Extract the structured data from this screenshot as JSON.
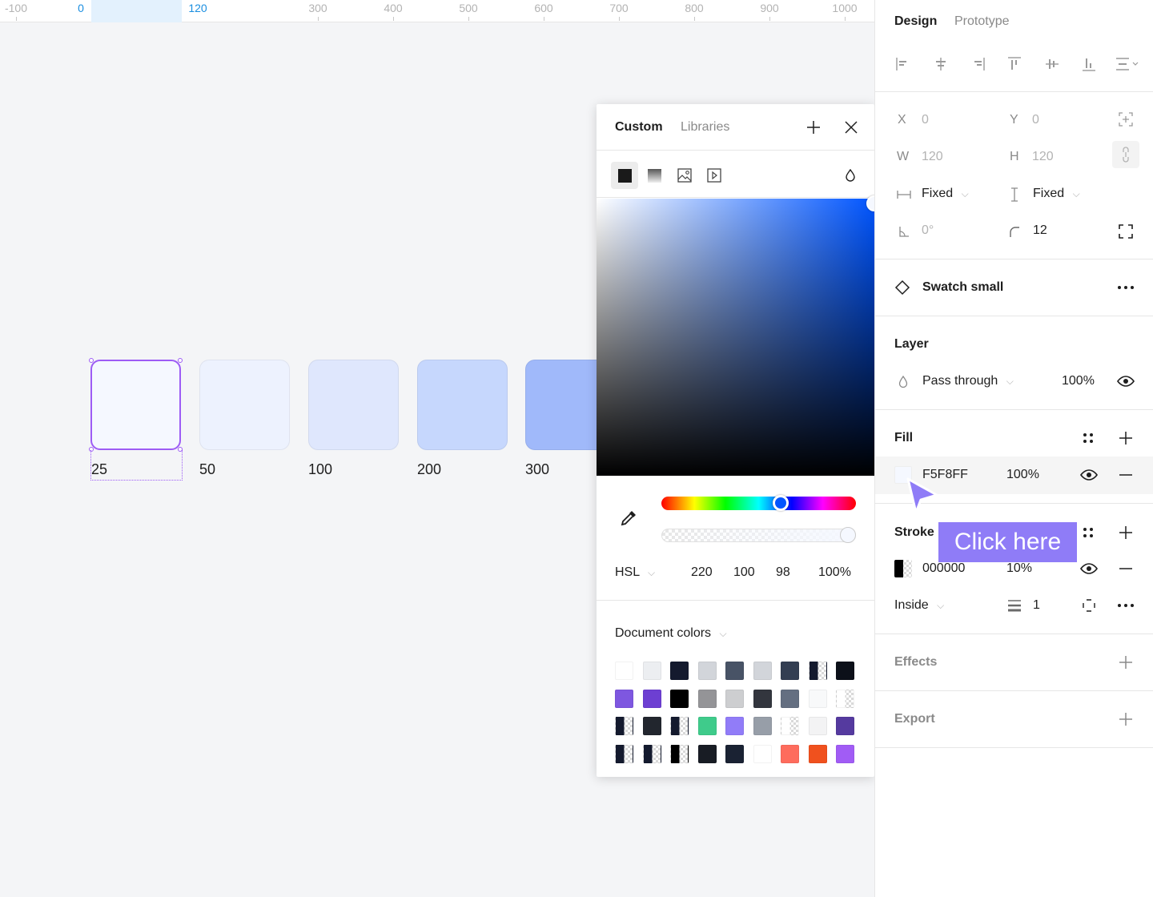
{
  "ruler": {
    "labels": [
      {
        "text": "-100",
        "active": false
      },
      {
        "text": "0",
        "active": true
      },
      {
        "text": "120",
        "active": true
      },
      {
        "text": "300",
        "active": false
      },
      {
        "text": "400",
        "active": false
      },
      {
        "text": "500",
        "active": false
      },
      {
        "text": "600",
        "active": false
      },
      {
        "text": "700",
        "active": false
      },
      {
        "text": "800",
        "active": false
      },
      {
        "text": "900",
        "active": false
      },
      {
        "text": "1000",
        "active": false
      }
    ]
  },
  "canvas": {
    "swatches": [
      {
        "label": "25",
        "color": "#F5F8FF",
        "selected": true
      },
      {
        "label": "50",
        "color": "#EDF2FE"
      },
      {
        "label": "100",
        "color": "#DFE7FD"
      },
      {
        "label": "200",
        "color": "#C6D7FD"
      },
      {
        "label": "300",
        "color": "#A0B9FA"
      }
    ],
    "selection_color": "#9D5CF5"
  },
  "picker": {
    "tabs": {
      "custom": "Custom",
      "libraries": "Libraries"
    },
    "icons": {
      "add": "plus-icon",
      "close": "close-icon",
      "solid": "solid-fill-icon",
      "gradient": "gradient-fill-icon",
      "image": "image-fill-icon",
      "video": "video-fill-icon",
      "blend": "blend-mode-icon",
      "eyedropper": "eyedropper-icon"
    },
    "hue_degrees": 220,
    "alpha_percent": 100,
    "mode": "HSL",
    "h": "220",
    "s": "100",
    "l": "98",
    "a": "100%",
    "doc_colors_label": "Document colors",
    "doc_colors": [
      {
        "c": "#FFFFFF"
      },
      {
        "c": "#ECEEF1"
      },
      {
        "c": "#141A2E"
      },
      {
        "c": "#D2D5DA"
      },
      {
        "c": "#485366"
      },
      {
        "c": "#D2D5DA"
      },
      {
        "c": "#333E52"
      },
      {
        "c": "#141A2E",
        "half": true
      },
      {
        "c": "#0C1019"
      },
      {
        "c": "#7E57E0"
      },
      {
        "c": "#6D3FD2"
      },
      {
        "c": "#000000"
      },
      {
        "c": "#949497"
      },
      {
        "c": "#CDCED0"
      },
      {
        "c": "#33363E"
      },
      {
        "c": "#646F81"
      },
      {
        "c": "#F8F9FA"
      },
      {
        "c": "#FFFFFF",
        "half": true
      },
      {
        "c": "#141A2E",
        "half": true
      },
      {
        "c": "#22262E"
      },
      {
        "c": "#141A2E",
        "half": true
      },
      {
        "c": "#3FCB8B"
      },
      {
        "c": "#917CF8"
      },
      {
        "c": "#979EA8"
      },
      {
        "c": "#FFFFFF",
        "half": true
      },
      {
        "c": "#F3F3F4"
      },
      {
        "c": "#553A9F"
      },
      {
        "c": "#141A2E",
        "half": true
      },
      {
        "c": "#141A2E",
        "half": true
      },
      {
        "c": "#000000",
        "half": true
      },
      {
        "c": "#181C24"
      },
      {
        "c": "#1A2233"
      },
      {
        "c": "#FFFFFF"
      },
      {
        "c": "#FE6C5D"
      },
      {
        "c": "#F0511E"
      },
      {
        "c": "#A15CF5"
      }
    ]
  },
  "panel": {
    "tabs": {
      "design": "Design",
      "prototype": "Prototype"
    },
    "align_icons": [
      "align-left-icon",
      "align-horizontal-center-icon",
      "align-right-icon",
      "align-top-icon",
      "align-vertical-center-icon",
      "align-bottom-icon",
      "distribute-icon"
    ],
    "x_label": "X",
    "x_value": "0",
    "y_label": "Y",
    "y_value": "0",
    "w_label": "W",
    "w_value": "120",
    "h_label": "H",
    "h_value": "120",
    "width_mode": "Fixed",
    "height_mode": "Fixed",
    "rotation": "0°",
    "radius": "12",
    "component_name": "Swatch small",
    "layer": {
      "title": "Layer",
      "blend": "Pass through",
      "opacity": "100%"
    },
    "fill": {
      "title": "Fill",
      "hex": "F5F8FF",
      "opacity": "100%",
      "color": "#F5F8FF"
    },
    "stroke": {
      "title": "Stroke",
      "hex": "000000",
      "opacity": "10%",
      "position": "Inside",
      "weight": "1"
    },
    "effects": {
      "title": "Effects"
    },
    "export": {
      "title": "Export"
    }
  },
  "tutorial": {
    "callout": "Click here",
    "color": "#8F7CF7"
  }
}
